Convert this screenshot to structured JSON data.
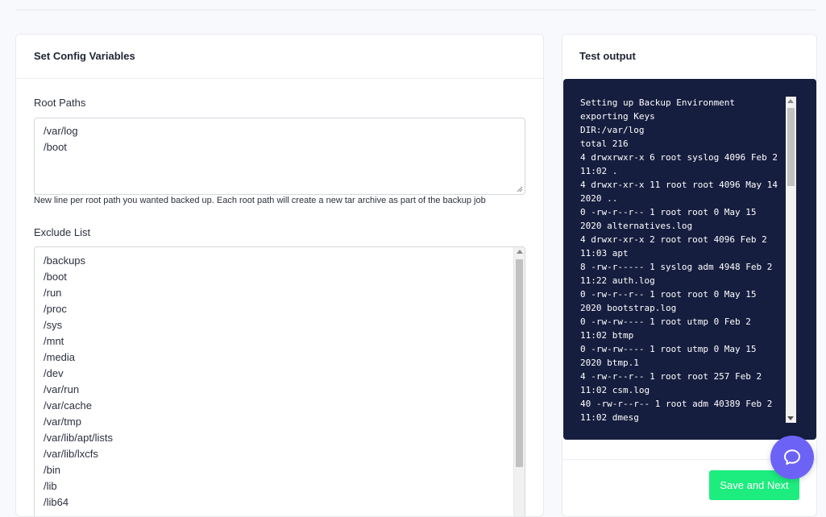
{
  "config_card": {
    "title": "Set Config Variables",
    "root_paths": {
      "label": "Root Paths",
      "lines": [
        "/var/log",
        "/boot"
      ],
      "help": "New line per root path you wanted backed up. Each root path will create a new tar archive as part of the backup job"
    },
    "exclude_list": {
      "label": "Exclude List",
      "lines": [
        "/backups",
        "/boot",
        "/run",
        "/proc",
        "/sys",
        "/mnt",
        "/media",
        "/dev",
        "/var/run",
        "/var/cache",
        "/var/tmp",
        "/var/lib/apt/lists",
        "/var/lib/lxcfs",
        "/bin",
        "/lib",
        "/lib64"
      ]
    }
  },
  "output_card": {
    "title": "Test output",
    "terminal_lines": [
      "Setting up Backup Environment",
      "exporting Keys",
      "DIR:/var/log",
      "total 216",
      "4 drwxrwxr-x 6 root syslog 4096 Feb 2 11:02 .",
      "4 drwxr-xr-x 11 root root 4096 May 14 2020 ..",
      "0 -rw-r--r-- 1 root root 0 May 15 2020 alternatives.log",
      "4 drwxr-xr-x 2 root root 4096 Feb 2 11:03 apt",
      "8 -rw-r----- 1 syslog adm 4948 Feb 2 11:22 auth.log",
      "0 -rw-r--r-- 1 root root 0 May 15 2020 bootstrap.log",
      "0 -rw-rw---- 1 root utmp 0 Feb 2 11:02 btmp",
      "0 -rw-rw---- 1 root utmp 0 May 15 2020 btmp.1",
      "4 -rw-r--r-- 1 root root 257 Feb 2 11:02 csm.log",
      "40 -rw-r--r-- 1 root adm 40389 Feb 2 11:02 dmesg"
    ],
    "save_label": "Save and Next"
  },
  "icons": {
    "help_launcher": "chat-bubble-icon"
  },
  "colors": {
    "terminal_bg": "#161e3f",
    "save_button": "#1ded7e",
    "launcher": "#6c63f6"
  }
}
